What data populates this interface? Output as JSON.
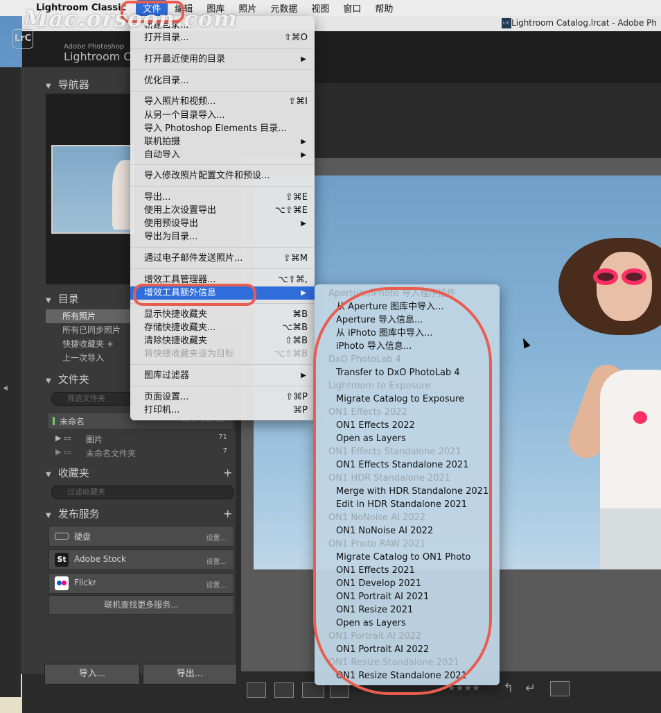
{
  "menubar": {
    "app_name": "Lightroom Classic",
    "items": [
      "文件",
      "编辑",
      "图库",
      "照片",
      "元数据",
      "视图",
      "窗口",
      "帮助"
    ]
  },
  "watermark": "Mac.orsoon.com",
  "window": {
    "title": "Lightroom Catalog.lrcat - Adobe Ph",
    "logo": "LrC",
    "brand_small": "Adobe Photoshop",
    "brand_big": "Lightroom Cla"
  },
  "left_panel": {
    "navigator": "导航器",
    "catalog": "目录",
    "catalog_items": [
      "所有照片",
      "所有已同步照片",
      "快捷收藏夹 +",
      "上一次导入"
    ],
    "folders": "文件夹",
    "folders_search": "筛选文件夹",
    "volume": {
      "name": "未命名",
      "size": "41.3 / 245 GB"
    },
    "folder_items": [
      {
        "name": "图片",
        "count": "71"
      },
      {
        "name": "未命名文件夹",
        "count": "7"
      }
    ],
    "collections": "收藏夹",
    "collections_search": "过滤收藏夹",
    "publish": "发布服务",
    "services": [
      {
        "name": "硬盘",
        "action": "设置..."
      },
      {
        "name": "Adobe Stock",
        "action": "设置..."
      },
      {
        "name": "Flickr",
        "action": "设置..."
      }
    ],
    "find_more": "联机查找更多服务...",
    "import_btn": "导入...",
    "export_btn": "导出..."
  },
  "file_menu": {
    "items": [
      {
        "label": "新建目录...",
        "shortcut": ""
      },
      {
        "label": "打开目录...",
        "shortcut": "⇧⌘O"
      },
      {
        "label": "打开最近使用的目录",
        "shortcut": "▶"
      },
      {
        "label": "优化目录...",
        "shortcut": ""
      },
      {
        "label": "导入照片和视频...",
        "shortcut": "⇧⌘I"
      },
      {
        "label": "从另一个目录导入...",
        "shortcut": ""
      },
      {
        "label": "导入 Photoshop Elements 目录...",
        "shortcut": ""
      },
      {
        "label": "联机拍摄",
        "shortcut": "▶"
      },
      {
        "label": "自动导入",
        "shortcut": "▶"
      },
      {
        "label": "导入修改照片配置文件和预设...",
        "shortcut": ""
      },
      {
        "label": "导出...",
        "shortcut": "⇧⌘E"
      },
      {
        "label": "使用上次设置导出",
        "shortcut": "⌥⇧⌘E"
      },
      {
        "label": "使用预设导出",
        "shortcut": "▶"
      },
      {
        "label": "导出为目录...",
        "shortcut": ""
      },
      {
        "label": "通过电子邮件发送照片...",
        "shortcut": "⇧⌘M"
      },
      {
        "label": "增效工具管理器...",
        "shortcut": "⌥⇧⌘,"
      },
      {
        "label": "增效工具额外信息",
        "shortcut": "▶"
      },
      {
        "label": "显示快捷收藏夹",
        "shortcut": "⌘B"
      },
      {
        "label": "存储快捷收藏夹...",
        "shortcut": "⌥⌘B"
      },
      {
        "label": "清除快捷收藏夹",
        "shortcut": "⇧⌘B"
      },
      {
        "label": "将快捷收藏夹设为目标",
        "shortcut": "⌥⇧⌘B"
      },
      {
        "label": "图库过滤器",
        "shortcut": "▶"
      },
      {
        "label": "页面设置...",
        "shortcut": "⇧⌘P"
      },
      {
        "label": "打印机...",
        "shortcut": "⌘P"
      }
    ]
  },
  "plugin_submenu": {
    "items": [
      {
        "label": "Aperture/iPhoto 导入程序插件",
        "header": true
      },
      {
        "label": "从 Aperture 图库中导入...",
        "header": false
      },
      {
        "label": "Aperture 导入信息...",
        "header": false
      },
      {
        "label": "从 iPhoto 图库中导入...",
        "header": false
      },
      {
        "label": "iPhoto 导入信息...",
        "header": false
      },
      {
        "label": "DxO PhotoLab 4",
        "header": true
      },
      {
        "label": "Transfer to DxO PhotoLab 4",
        "header": false
      },
      {
        "label": "Lightroom to Exposure",
        "header": true
      },
      {
        "label": "Migrate Catalog to Exposure",
        "header": false
      },
      {
        "label": "ON1 Effects 2022",
        "header": true
      },
      {
        "label": "ON1 Effects 2022",
        "header": false
      },
      {
        "label": "Open as Layers",
        "header": false
      },
      {
        "label": "ON1 Effects Standalone 2021",
        "header": true
      },
      {
        "label": "ON1 Effects Standalone 2021",
        "header": false
      },
      {
        "label": "ON1 HDR Standalone 2021",
        "header": true
      },
      {
        "label": "Merge with HDR Standalone 2021",
        "header": false
      },
      {
        "label": "Edit in HDR Standalone 2021",
        "header": false
      },
      {
        "label": "ON1 NoNoise AI 2022",
        "header": true
      },
      {
        "label": "ON1 NoNoise AI 2022",
        "header": false
      },
      {
        "label": "ON1 Photo RAW 2021",
        "header": true
      },
      {
        "label": "Migrate Catalog to ON1 Photo",
        "header": false
      },
      {
        "label": "ON1 Effects 2021",
        "header": false
      },
      {
        "label": "ON1 Develop 2021",
        "header": false
      },
      {
        "label": "ON1 Portrait AI 2021",
        "header": false
      },
      {
        "label": "ON1 Resize 2021",
        "header": false
      },
      {
        "label": "Open as Layers",
        "header": false
      },
      {
        "label": "ON1 Portrait AI 2022",
        "header": true
      },
      {
        "label": "ON1 Portrait AI 2022",
        "header": false
      },
      {
        "label": "ON1 Resize Standalone 2021",
        "header": true
      },
      {
        "label": "ON1 Resize Standalone 2021",
        "header": false
      }
    ]
  },
  "colors": {
    "accent": "#2f6ddb",
    "annotation": "#e85d4f"
  }
}
